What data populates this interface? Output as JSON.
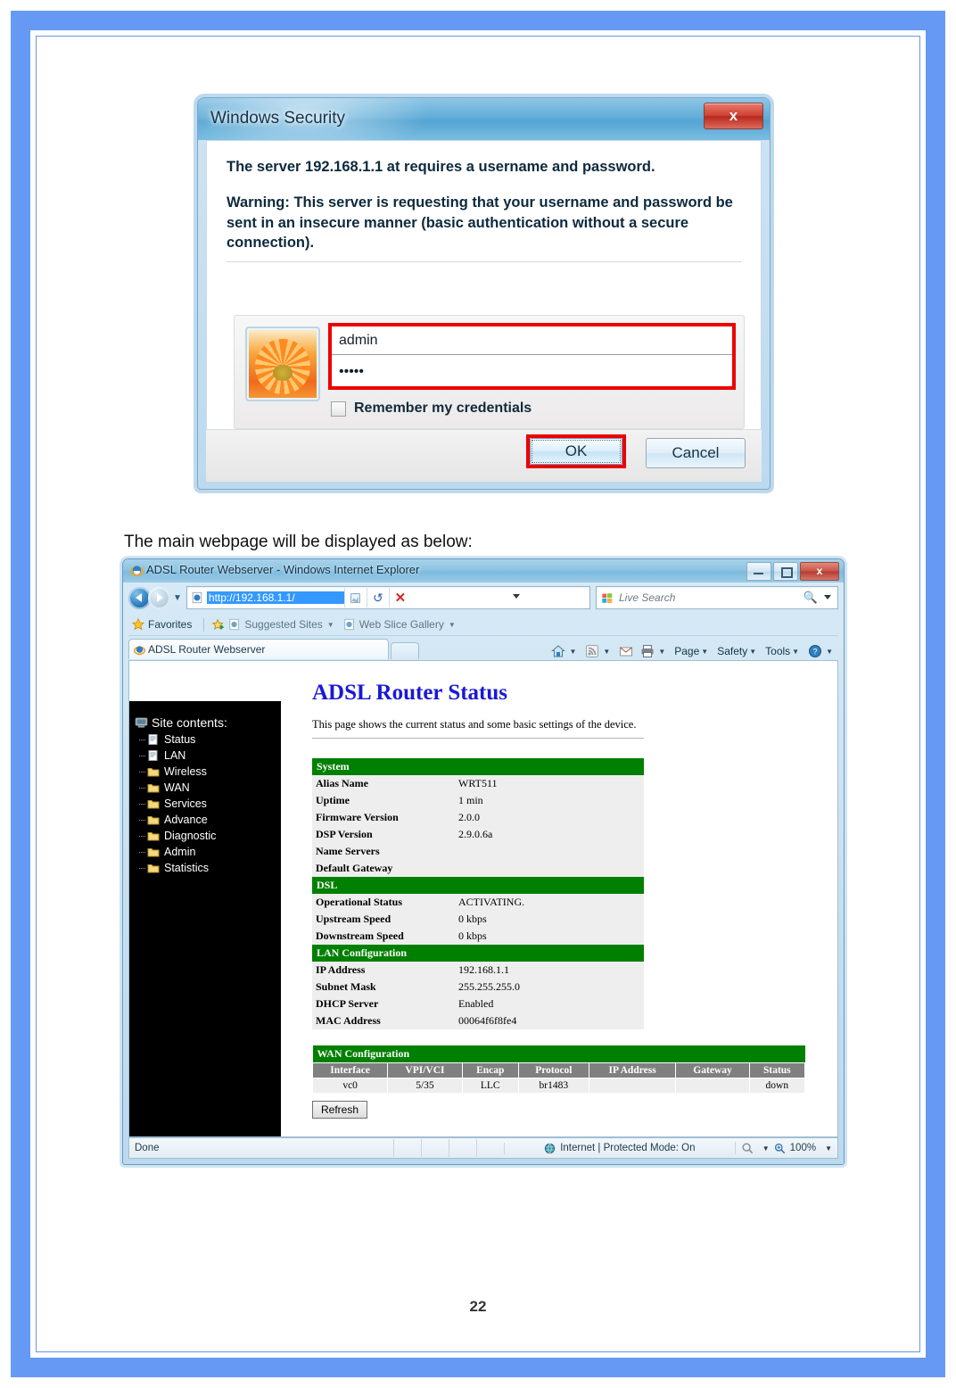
{
  "document": {
    "page_number": "22",
    "caption": "The main webpage will be displayed as below:"
  },
  "security_dialog": {
    "title": "Windows Security",
    "close_label": "x",
    "message_line1": "The server 192.168.1.1 at  requires a username and password.",
    "message_line2": "Warning: This server is requesting that your username and password be sent in an insecure manner (basic authentication without a secure connection).",
    "username_value": "admin",
    "password_value": "•••••",
    "remember_label": "Remember my credentials",
    "ok_label": "OK",
    "cancel_label": "Cancel",
    "highlight_color": "#ee0000"
  },
  "browser": {
    "window_title": "ADSL Router Webserver - Windows Internet Explorer",
    "minimize_label": "",
    "maximize_label": "",
    "close_label": "x",
    "address_value": "http://192.168.1.1/",
    "search_placeholder": "Live Search",
    "favorites_label": "Favorites",
    "suggested_sites_label": "Suggested Sites",
    "web_slice_label": "Web Slice Gallery",
    "tab_label": "ADSL Router Webserver",
    "command_bar": [
      {
        "label": "Page"
      },
      {
        "label": "Safety"
      },
      {
        "label": "Tools"
      }
    ],
    "status": {
      "done_label": "Done",
      "zone_label": "Internet | Protected Mode: On",
      "zoom_label": "100%"
    }
  },
  "router": {
    "sidebar_title": "Site contents:",
    "sidebar_items": [
      {
        "label": "Status",
        "icon": "page-icon"
      },
      {
        "label": "LAN",
        "icon": "page-icon"
      },
      {
        "label": "Wireless",
        "icon": "folder-icon"
      },
      {
        "label": "WAN",
        "icon": "folder-icon"
      },
      {
        "label": "Services",
        "icon": "folder-icon"
      },
      {
        "label": "Advance",
        "icon": "folder-icon"
      },
      {
        "label": "Diagnostic",
        "icon": "folder-icon"
      },
      {
        "label": "Admin",
        "icon": "folder-icon"
      },
      {
        "label": "Statistics",
        "icon": "folder-icon"
      }
    ],
    "heading": "ADSL Router Status",
    "description": "This page shows the current status and some basic settings of the device.",
    "sections": [
      {
        "name": "System",
        "rows": [
          {
            "label": "Alias Name",
            "value": "WRT511"
          },
          {
            "label": "Uptime",
            "value": "1 min"
          },
          {
            "label": "Firmware Version",
            "value": "2.0.0"
          },
          {
            "label": "DSP Version",
            "value": "2.9.0.6a"
          },
          {
            "label": "Name Servers",
            "value": ""
          },
          {
            "label": "Default Gateway",
            "value": ""
          }
        ]
      },
      {
        "name": "DSL",
        "rows": [
          {
            "label": "Operational Status",
            "value": "ACTIVATING."
          },
          {
            "label": "Upstream Speed",
            "value": "0 kbps"
          },
          {
            "label": "Downstream Speed",
            "value": "0 kbps"
          }
        ]
      },
      {
        "name": "LAN Configuration",
        "rows": [
          {
            "label": "IP Address",
            "value": "192.168.1.1"
          },
          {
            "label": "Subnet Mask",
            "value": "255.255.255.0"
          },
          {
            "label": "DHCP Server",
            "value": "Enabled"
          },
          {
            "label": "MAC Address",
            "value": "00064f6f8fe4"
          }
        ]
      }
    ],
    "wan": {
      "title": "WAN Configuration",
      "columns": [
        "Interface",
        "VPI/VCI",
        "Encap",
        "Protocol",
        "IP Address",
        "Gateway",
        "Status"
      ],
      "rows": [
        [
          "vc0",
          "5/35",
          "LLC",
          "br1483",
          "",
          "",
          "down"
        ]
      ]
    },
    "refresh_label": "Refresh",
    "accent_colors": {
      "section_header": "#008000",
      "table_header": "#808080",
      "heading": "#1919d6"
    }
  }
}
